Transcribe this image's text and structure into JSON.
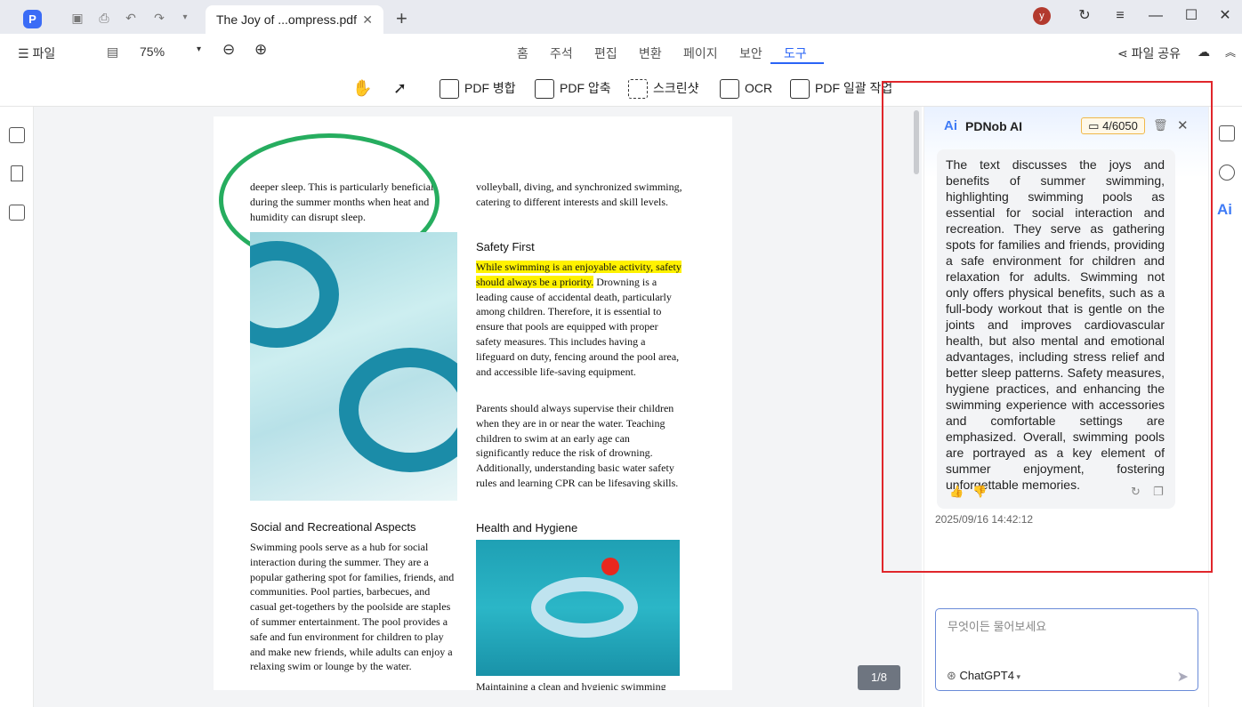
{
  "titlebar": {
    "tab_title": "The Joy of ...ompress.pdf",
    "avatar_letter": "y"
  },
  "menubar": {
    "file_label": "파일",
    "zoom": "75%",
    "tabs": [
      "홈",
      "주석",
      "편집",
      "변환",
      "페이지",
      "보안",
      "도구"
    ],
    "active_tab": "도구",
    "share_label": "파일 공유"
  },
  "toolbar": {
    "tools": [
      "PDF 병합",
      "PDF 압축",
      "스크린샷",
      "OCR",
      "PDF 일괄 작업"
    ]
  },
  "document": {
    "page_indicator": "1/8",
    "col1_top": "deeper sleep. This is particularly beneficial during the summer months when heat and humidity can disrupt sleep.",
    "col2_top": "volleyball, diving, and synchronized swimming, catering to different interests and skill levels.",
    "safety_heading": "Safety First",
    "safety_highlight": "While swimming is an enjoyable activity, safety should always be a priority.",
    "safety_body": " Drowning is a leading cause of accidental death, particularly among children. Therefore, it is essential to ensure that pools are equipped with proper safety measures. This includes having a lifeguard on duty, fencing around the pool area, and accessible life-saving equipment.",
    "parents_para": "Parents should always supervise their children when they are in or near the water. Teaching children to swim at an early age can significantly reduce the risk of drowning. Additionally, understanding basic water safety rules and learning CPR can be lifesaving skills.",
    "social_heading": "Social and Recreational Aspects",
    "social_body": "Swimming pools serve as a hub for social interaction during the summer. They are a popular gathering spot for families, friends, and communities. Pool parties, barbecues, and casual get-togethers by the poolside are staples of summer entertainment. The pool provides a safe and fun environment for children to play and make new friends, while adults can enjoy a relaxing swim or lounge by the water.",
    "health_heading": "Health and Hygiene",
    "health_body": "Maintaining a clean and hygienic swimming"
  },
  "ai": {
    "title": "PDNob AI",
    "quota": "4/6050",
    "response": "The text discusses the joys and benefits of summer swimming, highlighting swimming pools as essential for social interaction and recreation. They serve as gathering spots for families and friends, providing a safe environment for children and relaxation for adults. Swimming not only offers physical benefits, such as a full-body workout that is gentle on the joints and improves cardiovascular health, but also mental and emotional advantages, including stress relief and better sleep patterns. Safety measures, hygiene practices, and enhancing the swimming experience with accessories and comfortable settings are emphasized. Overall, swimming pools are portrayed as a key element of summer enjoyment, fostering unforgettable memories.",
    "timestamp": "2025/09/16 14:42:12",
    "input_placeholder": "무엇이든 물어보세요",
    "model": "ChatGPT4"
  }
}
